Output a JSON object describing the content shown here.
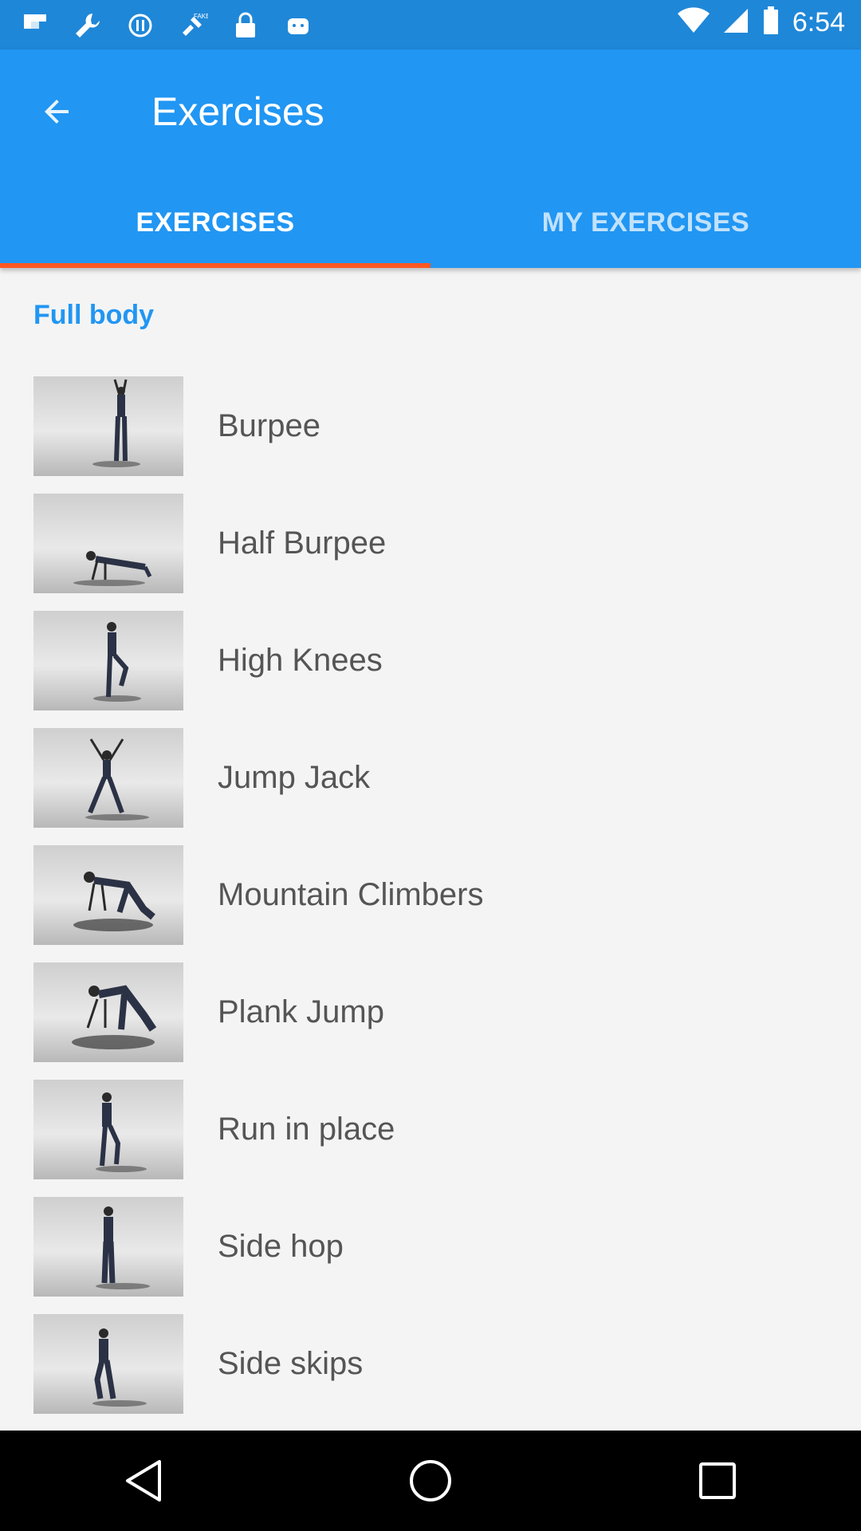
{
  "status_bar": {
    "time": "6:54",
    "icons": [
      "flipboard-icon",
      "wrench-icon",
      "sync-icon",
      "fake-gps-icon",
      "lock-icon",
      "android-icon"
    ],
    "right_icons": [
      "wifi-icon",
      "signal-icon",
      "battery-icon"
    ]
  },
  "app_bar": {
    "title": "Exercises",
    "back_icon": "arrow-left-icon"
  },
  "tabs": [
    {
      "label": "EXERCISES",
      "active": true
    },
    {
      "label": "MY EXERCISES",
      "active": false
    }
  ],
  "section": {
    "title": "Full body"
  },
  "exercises": [
    {
      "name": "Burpee",
      "pose": "arms-up"
    },
    {
      "name": "Half Burpee",
      "pose": "plank"
    },
    {
      "name": "High Knees",
      "pose": "knee-up"
    },
    {
      "name": "Jump Jack",
      "pose": "star"
    },
    {
      "name": "Mountain Climbers",
      "pose": "crawl"
    },
    {
      "name": "Plank Jump",
      "pose": "crawl"
    },
    {
      "name": "Run in place",
      "pose": "stand"
    },
    {
      "name": "Side hop",
      "pose": "stand"
    },
    {
      "name": "Side skips",
      "pose": "knee-up"
    }
  ],
  "nav_bar": {
    "icons": [
      "back-triangle-icon",
      "home-circle-icon",
      "recents-square-icon"
    ]
  },
  "colors": {
    "primary": "#2196f3",
    "primary_dark": "#1f87d8",
    "accent": "#ff5722",
    "background": "#f4f4f4"
  }
}
